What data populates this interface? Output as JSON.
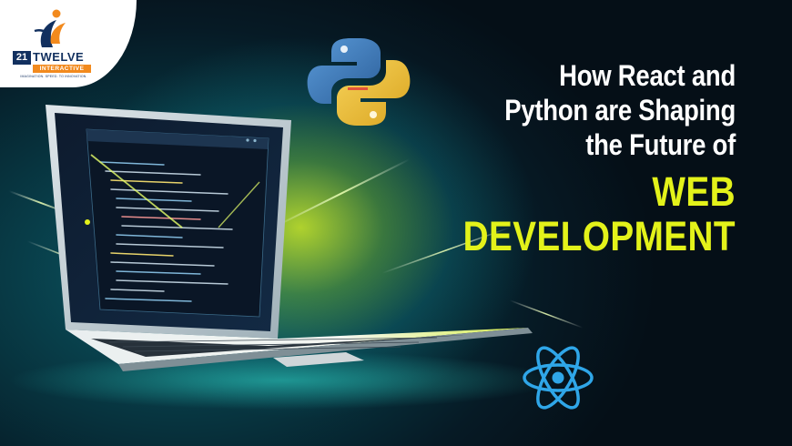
{
  "logo": {
    "number": "21",
    "name": "TWELVE",
    "subtitle": "INTERACTIVE",
    "tagline": "IMAGINATION. SPEED. TO INNOVATION."
  },
  "headline": {
    "lines": [
      "How React and",
      "Python are Shaping",
      "the Future of"
    ],
    "emphasis": [
      "WEB",
      "DEVELOPMENT"
    ]
  },
  "colors": {
    "accent_yellow": "#e3f21a",
    "logo_navy": "#12305f",
    "logo_orange": "#f28a1e",
    "react_blue": "#2fa6e8",
    "python_blue": "#3a77b8",
    "python_yellow": "#f2c43a"
  },
  "icons": [
    "python-logo-icon",
    "react-logo-icon",
    "laptop-illustration"
  ]
}
